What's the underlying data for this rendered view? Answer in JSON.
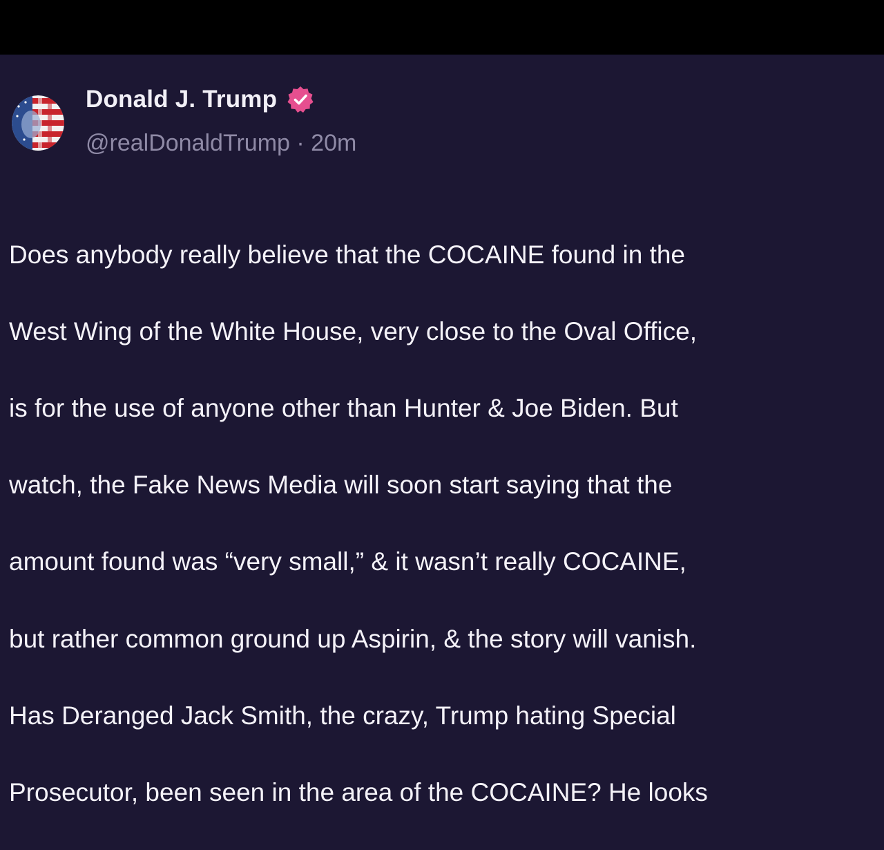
{
  "post": {
    "author_name": "Donald J. Trump",
    "handle": "@realDonaldTrump",
    "separator": "·",
    "time_ago": "20m",
    "verified_icon": "verified-badge-icon",
    "avatar_icon": "flag-portrait-avatar",
    "text_lines": [
      "Does anybody really believe that the COCAINE found in the",
      "West Wing of the White House, very close to the Oval Office,",
      "is for the use of anyone other than Hunter & Joe Biden. But",
      "watch, the Fake News Media will soon start saying that the",
      "amount found was “very small,” & it wasn’t really COCAINE,",
      "but rather common ground up Aspirin, & the story will vanish.",
      "Has Deranged Jack Smith, the crazy, Trump hating Special",
      "Prosecutor, been seen in the area of the COCAINE? He looks"
    ]
  },
  "colors": {
    "background": "#1c1733",
    "top_bar": "#000000",
    "badge": "#e64f8f",
    "text": "#f4f2f8",
    "muted": "#8f8aa6"
  }
}
